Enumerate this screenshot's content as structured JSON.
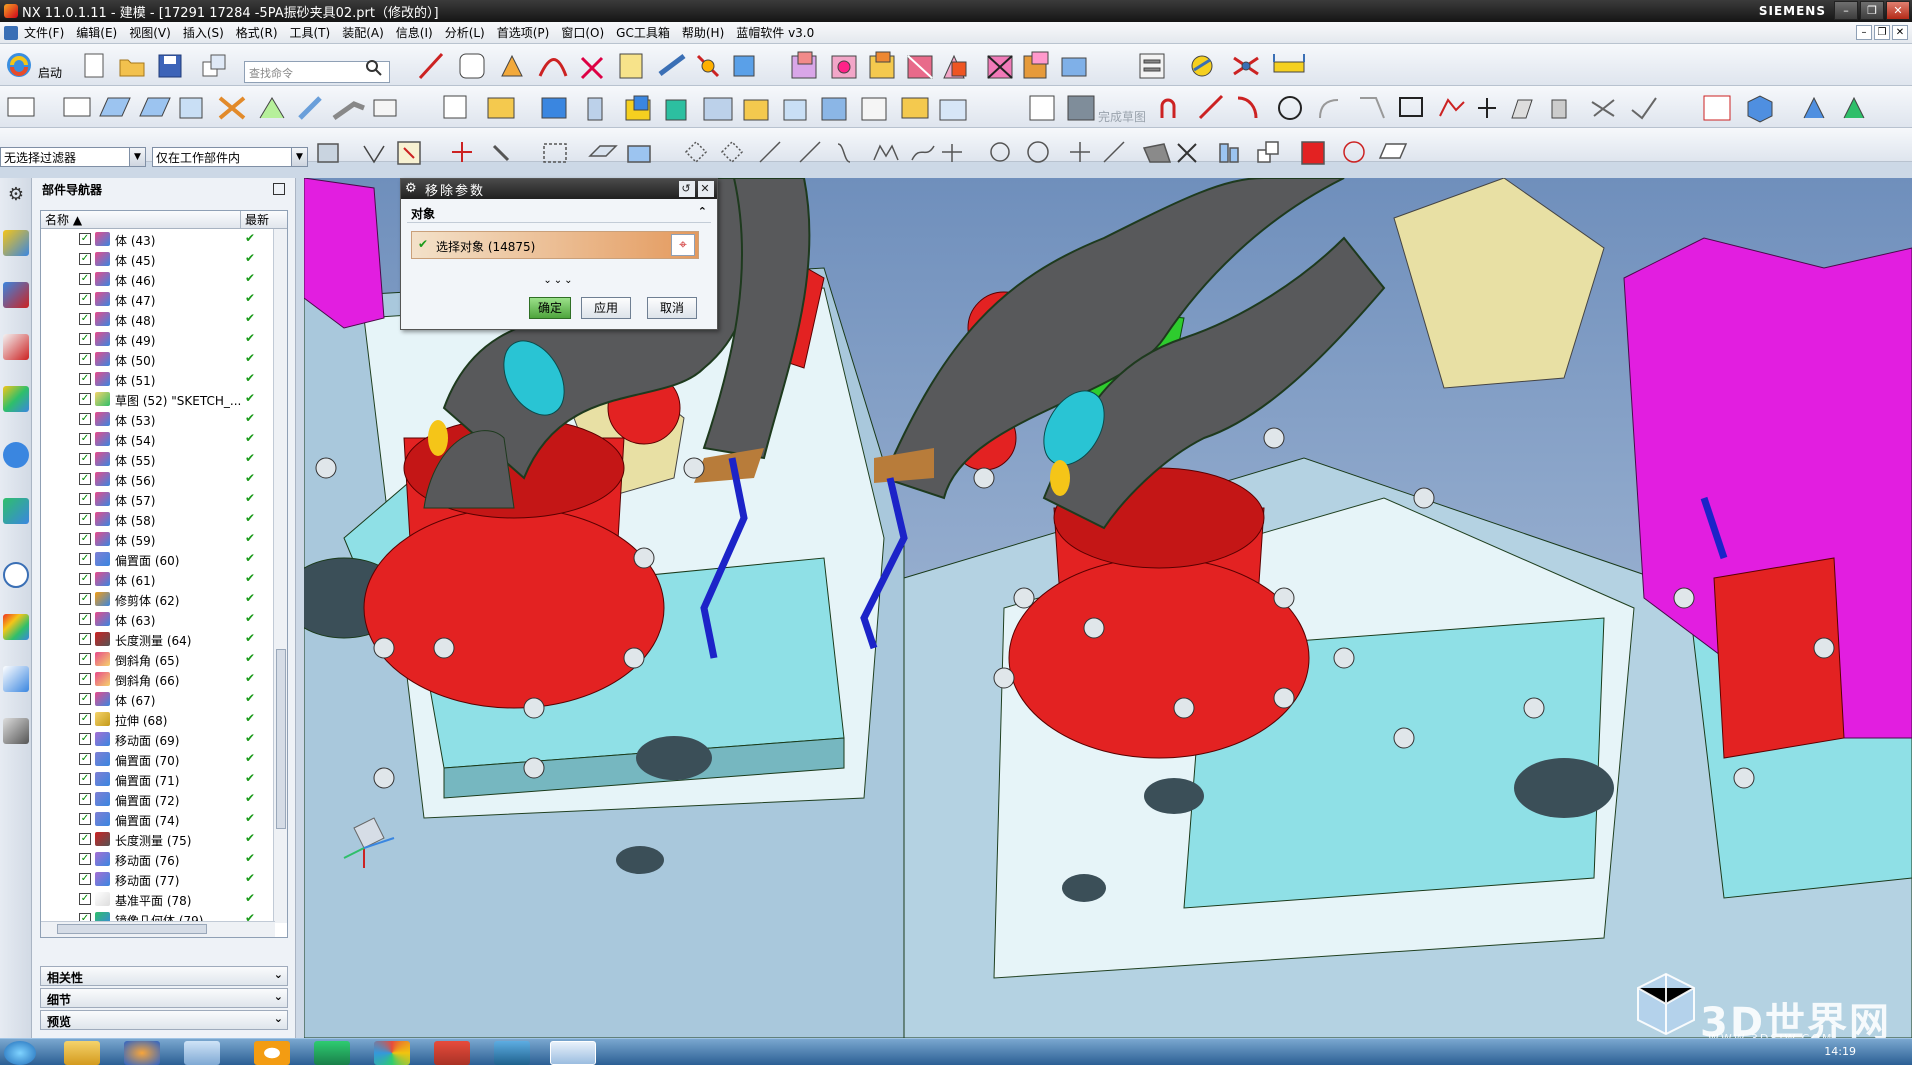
{
  "window": {
    "title": "NX 11.0.1.11 - 建模 - [17291 17284 -5PA振砂夹具02.prt（修改的）]",
    "brand": "SIEMENS",
    "buttons": {
      "minimize": "–",
      "restore": "❐",
      "close": "✕"
    }
  },
  "menubar": {
    "items": [
      "文件(F)",
      "编辑(E)",
      "视图(V)",
      "插入(S)",
      "格式(R)",
      "工具(T)",
      "装配(A)",
      "信息(I)",
      "分析(L)",
      "首选项(P)",
      "窗口(O)",
      "GC工具箱",
      "帮助(H)",
      "蓝帽软件 v3.0"
    ]
  },
  "toolbar": {
    "start_label": "启动",
    "search_placeholder": "查找命令",
    "filter_value": "无选择过滤器",
    "scope_value": "仅在工作部件内",
    "sketch_finish": "完成草图"
  },
  "navigator": {
    "title": "部件导航器",
    "col_name": "名称",
    "col_latest": "最新",
    "rows": [
      {
        "label": "体 (43)",
        "type": "body"
      },
      {
        "label": "体 (45)",
        "type": "body"
      },
      {
        "label": "体 (46)",
        "type": "body"
      },
      {
        "label": "体 (47)",
        "type": "body"
      },
      {
        "label": "体 (48)",
        "type": "body"
      },
      {
        "label": "体 (49)",
        "type": "body"
      },
      {
        "label": "体 (50)",
        "type": "body"
      },
      {
        "label": "体 (51)",
        "type": "body"
      },
      {
        "label": "草图 (52) \"SKETCH_...",
        "type": "sketch"
      },
      {
        "label": "体 (53)",
        "type": "body"
      },
      {
        "label": "体 (54)",
        "type": "body"
      },
      {
        "label": "体 (55)",
        "type": "body"
      },
      {
        "label": "体 (56)",
        "type": "body"
      },
      {
        "label": "体 (57)",
        "type": "body"
      },
      {
        "label": "体 (58)",
        "type": "body"
      },
      {
        "label": "体 (59)",
        "type": "body"
      },
      {
        "label": "偏置面 (60)",
        "type": "offset"
      },
      {
        "label": "体 (61)",
        "type": "body"
      },
      {
        "label": "修剪体 (62)",
        "type": "trim"
      },
      {
        "label": "体 (63)",
        "type": "body"
      },
      {
        "label": "长度测量 (64)",
        "type": "measure"
      },
      {
        "label": "倒斜角 (65)",
        "type": "chamfer"
      },
      {
        "label": "倒斜角 (66)",
        "type": "chamfer"
      },
      {
        "label": "体 (67)",
        "type": "body"
      },
      {
        "label": "拉伸 (68)",
        "type": "extrude"
      },
      {
        "label": "移动面 (69)",
        "type": "move"
      },
      {
        "label": "偏置面 (70)",
        "type": "offset"
      },
      {
        "label": "偏置面 (71)",
        "type": "offset"
      },
      {
        "label": "偏置面 (72)",
        "type": "offset"
      },
      {
        "label": "偏置面 (74)",
        "type": "offset"
      },
      {
        "label": "长度测量 (75)",
        "type": "measure"
      },
      {
        "label": "移动面 (76)",
        "type": "move"
      },
      {
        "label": "移动面 (77)",
        "type": "move"
      },
      {
        "label": "基准平面 (78)",
        "type": "datum"
      },
      {
        "label": "镜像几何体 (79)",
        "type": "mirror"
      }
    ],
    "panels": [
      "相关性",
      "细节",
      "预览"
    ]
  },
  "dialog": {
    "title": "移除参数",
    "section": "对象",
    "select_label": "选择对象 (14875)",
    "ok": "确定",
    "apply": "应用",
    "cancel": "取消"
  },
  "watermark": {
    "main": "3D世界网",
    "sub": "WWW.3DSJW.COM"
  },
  "taskbar": {
    "time": "14:19"
  },
  "colors": {
    "fixture_red": "#e32222",
    "pipe_gray": "#58595b",
    "base_cyan": "#8fe0e6",
    "magenta": "#e21ee0",
    "pad_yellow": "#e8e0a4",
    "green": "#2ecc2e"
  }
}
